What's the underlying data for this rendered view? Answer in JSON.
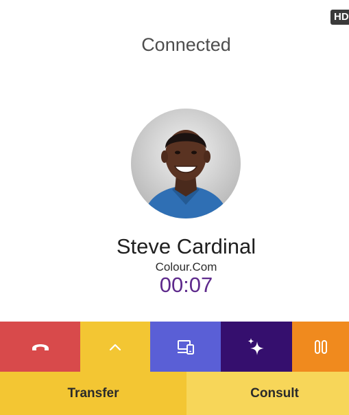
{
  "header": {
    "hd_badge": "HD"
  },
  "call": {
    "status": "Connected",
    "contact_name": "Steve Cardinal",
    "company": "Colour.Com",
    "duration": "00:07"
  },
  "actions": [
    {
      "icon": "hang-up-icon",
      "color": "#d84a4b"
    },
    {
      "icon": "chevron-up-icon",
      "color": "#f3c633"
    },
    {
      "icon": "devices-icon",
      "color": "#5a5fd6"
    },
    {
      "icon": "sparkle-icon",
      "color": "#350f6e"
    },
    {
      "icon": "pause-icon",
      "color": "#f08a1e"
    }
  ],
  "bottom": {
    "transfer_label": "Transfer",
    "consult_label": "Consult"
  },
  "colors": {
    "timer": "#5e2a8c",
    "transfer_bg": "#f3c633",
    "consult_bg": "#f7d659"
  }
}
